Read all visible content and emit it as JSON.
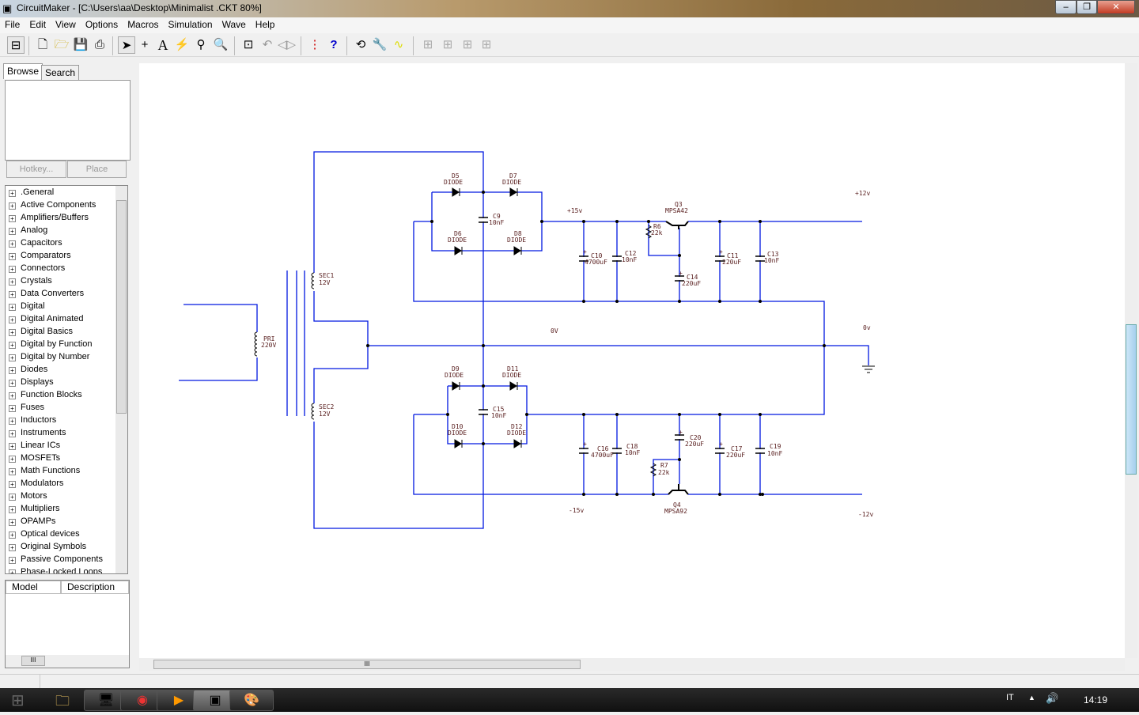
{
  "window": {
    "title": "CircuitMaker - [C:\\Users\\aa\\Desktop\\Minimalist .CKT 80%]"
  },
  "menu": [
    "File",
    "Edit",
    "View",
    "Options",
    "Macros",
    "Simulation",
    "Wave",
    "Help"
  ],
  "left_panel": {
    "tabs": [
      "Browse",
      "Search"
    ],
    "hotkey_label": "Hotkey...",
    "place_label": "Place",
    "tree": [
      ".General",
      "Active Components",
      "Amplifiers/Buffers",
      "Analog",
      "Capacitors",
      "Comparators",
      "Connectors",
      "Crystals",
      "Data Converters",
      "Digital",
      "Digital Animated",
      "Digital Basics",
      "Digital by Function",
      "Digital by Number",
      "Diodes",
      "Displays",
      "Function Blocks",
      "Fuses",
      "Inductors",
      "Instruments",
      "Linear ICs",
      "MOSFETs",
      "Math Functions",
      "Modulators",
      "Motors",
      "Multipliers",
      "OPAMPs",
      "Optical devices",
      "Original Symbols",
      "Passive Components",
      "Phase-Locked Loops"
    ],
    "columns": [
      "Model",
      "Description"
    ]
  },
  "schematic": {
    "pri": [
      "PRI",
      "220V"
    ],
    "sec1": [
      "SEC1",
      "12V"
    ],
    "sec2": [
      "SEC2",
      "12V"
    ],
    "net_labels": {
      "p15": "+15v",
      "p12": "+12v",
      "ov_mid": "0V",
      "ov_right": "0v",
      "m15": "-15v",
      "m12": "-12v"
    },
    "diodes": {
      "D5": "D5",
      "D6": "D6",
      "D7": "D7",
      "D8": "D8",
      "D9": "D9",
      "D10": "D10",
      "D11": "D11",
      "D12": "D12",
      "type": "DIODE"
    },
    "caps": {
      "C9": [
        "C9",
        "10nF"
      ],
      "C10": [
        "C10",
        "4700uF"
      ],
      "C11": [
        "C11",
        "220uF"
      ],
      "C12": [
        "C12",
        "10nF"
      ],
      "C13": [
        "C13",
        "10nF"
      ],
      "C14": [
        "C14",
        "220uF"
      ],
      "C15": [
        "C15",
        "10nF"
      ],
      "C16": [
        "C16",
        "4700uF"
      ],
      "C17": [
        "C17",
        "220uF"
      ],
      "C18": [
        "C18",
        "10nF"
      ],
      "C19": [
        "C19",
        "10nF"
      ],
      "C20": [
        "C20",
        "220uF"
      ]
    },
    "resistors": {
      "R6": [
        "R6",
        "22k"
      ],
      "R7": [
        "R7",
        "22k"
      ]
    },
    "transistors": {
      "Q3": [
        "Q3",
        "MPSA42"
      ],
      "Q4": [
        "Q4",
        "MPSA92"
      ]
    },
    "wire_color": "#0018e0"
  },
  "taskbar": {
    "lang": "IT",
    "clock": "14:19"
  }
}
